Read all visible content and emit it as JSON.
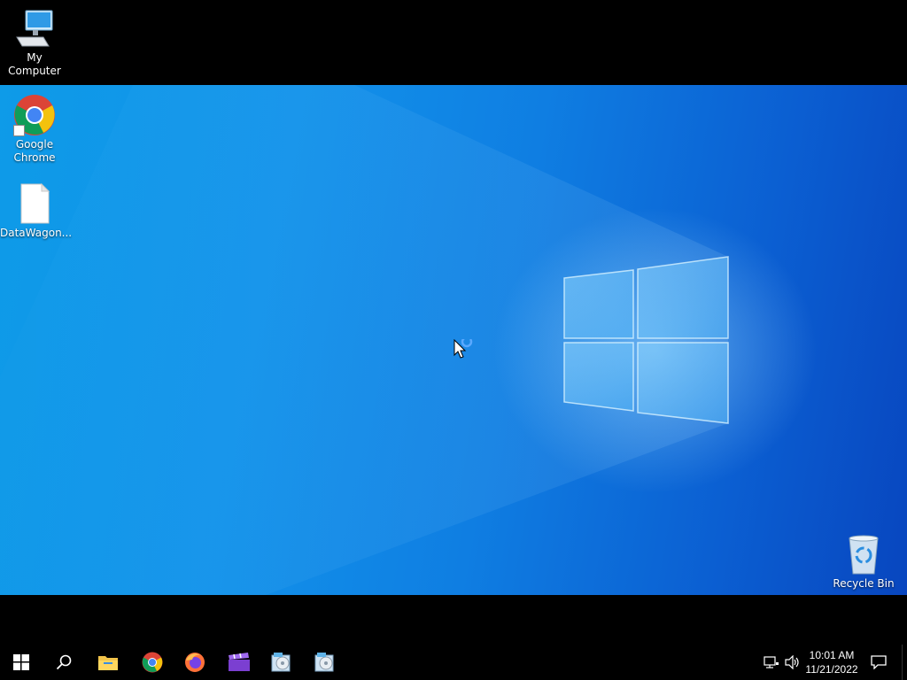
{
  "desktop": {
    "icons": [
      {
        "label": "My Computer",
        "icon": "computer-icon"
      },
      {
        "label": "Google Chrome",
        "icon": "chrome-icon"
      },
      {
        "label": "DataWagon...",
        "icon": "file-icon"
      },
      {
        "label": "Recycle Bin",
        "icon": "recycle-bin-icon"
      }
    ]
  },
  "taskbar": {
    "buttons": [
      {
        "name": "start-button",
        "icon": "windows-logo-icon"
      },
      {
        "name": "search-button",
        "icon": "search-icon"
      },
      {
        "name": "file-explorer-button",
        "icon": "folder-icon"
      },
      {
        "name": "chrome-button",
        "icon": "chrome-icon"
      },
      {
        "name": "firefox-button",
        "icon": "firefox-icon"
      },
      {
        "name": "video-app-button",
        "icon": "clapperboard-icon"
      },
      {
        "name": "installer-app-button-1",
        "icon": "installer-icon"
      },
      {
        "name": "installer-app-button-2",
        "icon": "installer-icon"
      }
    ],
    "tray": {
      "network_icon": "network-icon",
      "volume_icon": "volume-icon",
      "time": "10:01 AM",
      "date": "11/21/2022",
      "notification_icon": "notification-icon"
    }
  },
  "colors": {
    "wallpaper_light": "#1292ea",
    "wallpaper_dark": "#0846bf",
    "taskbar": "#000000"
  }
}
